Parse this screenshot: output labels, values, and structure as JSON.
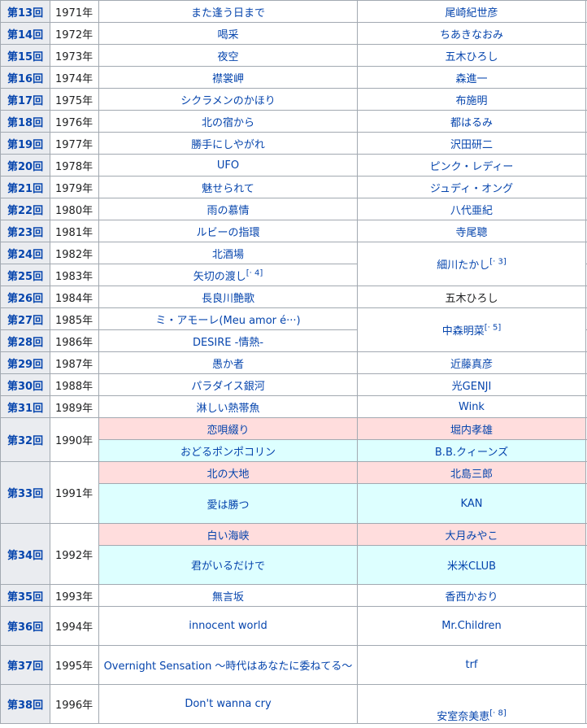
{
  "rows": [
    {
      "edition": "第13回",
      "year": "1971年",
      "song": "また逢う日まで",
      "artist": "尾崎紀世彦"
    },
    {
      "edition": "第14回",
      "year": "1972年",
      "song": "喝采",
      "artist": "ちあきなおみ"
    },
    {
      "edition": "第15回",
      "year": "1973年",
      "song": "夜空",
      "artist": "五木ひろし"
    },
    {
      "edition": "第16回",
      "year": "1974年",
      "song": "襟裳岬",
      "artist": "森進一"
    },
    {
      "edition": "第17回",
      "year": "1975年",
      "song": "シクラメンのかほり",
      "artist": "布施明"
    },
    {
      "edition": "第18回",
      "year": "1976年",
      "song": "北の宿から",
      "artist": "都はるみ"
    },
    {
      "edition": "第19回",
      "year": "1977年",
      "song": "勝手にしやがれ",
      "artist": "沢田研二"
    },
    {
      "edition": "第20回",
      "year": "1978年",
      "song": "UFO",
      "artist": "ピンク・レディー"
    },
    {
      "edition": "第21回",
      "year": "1979年",
      "song": "魅せられて",
      "artist": "ジュディ・オング"
    },
    {
      "edition": "第22回",
      "year": "1980年",
      "song": "雨の慕情",
      "artist": "八代亜紀"
    },
    {
      "edition": "第23回",
      "year": "1981年",
      "song": "ルビーの指環",
      "artist": "寺尾聰"
    },
    {
      "edition": "第24回",
      "year": "1982年",
      "song": "北酒場",
      "artist": "細川たかし",
      "artist_note": "[· 3]"
    },
    {
      "edition": "第25回",
      "year": "1983年",
      "song": "矢切の渡し",
      "song_note": "[· 4]"
    },
    {
      "edition": "第26回",
      "year": "1984年",
      "song": "長良川艶歌",
      "artist": "五木ひろし"
    },
    {
      "edition": "第27回",
      "year": "1985年",
      "song": "ミ・アモーレ(Meu amor é···)",
      "artist": "中森明菜",
      "artist_note": "[· 5]"
    },
    {
      "edition": "第28回",
      "year": "1986年",
      "song": "DESIRE -情熱-"
    },
    {
      "edition": "第29回",
      "year": "1987年",
      "song": "愚か者",
      "artist": "近藤真彦"
    },
    {
      "edition": "第30回",
      "year": "1988年",
      "song": "パラダイス銀河",
      "artist": "光GENJI"
    },
    {
      "edition": "第31回",
      "year": "1989年",
      "song": "淋しい熱帯魚",
      "artist": "Wink"
    },
    {
      "edition": "第32回",
      "year": "1990年",
      "pairs": [
        {
          "song": "恋唄綴り",
          "artist": "堀内孝雄"
        },
        {
          "song": "おどるポンポコリン",
          "artist": "B.B.クィーンズ"
        }
      ]
    },
    {
      "edition": "第33回",
      "year": "1991年",
      "pairs": [
        {
          "song": "北の大地",
          "artist": "北島三郎"
        },
        {
          "song": "愛は勝つ",
          "artist": "KAN"
        }
      ]
    },
    {
      "edition": "第34回",
      "year": "1992年",
      "pairs": [
        {
          "song": "白い海峡",
          "artist": "大月みやこ"
        },
        {
          "song": "君がいるだけで",
          "artist": "米米CLUB"
        }
      ]
    },
    {
      "edition": "第35回",
      "year": "1993年",
      "song": "無言坂",
      "artist": "香西かおり"
    },
    {
      "edition": "第36回",
      "year": "1994年",
      "song": "innocent world",
      "artist": "Mr.Children"
    },
    {
      "edition": "第37回",
      "year": "1995年",
      "song": "Overnight Sensation 〜時代はあなたに委ねてる〜",
      "artist": "trf"
    },
    {
      "edition": "第38回",
      "year": "1996年",
      "song": "Don't wanna cry",
      "artist": "安室奈美恵",
      "artist_note": "[· 8]"
    }
  ]
}
